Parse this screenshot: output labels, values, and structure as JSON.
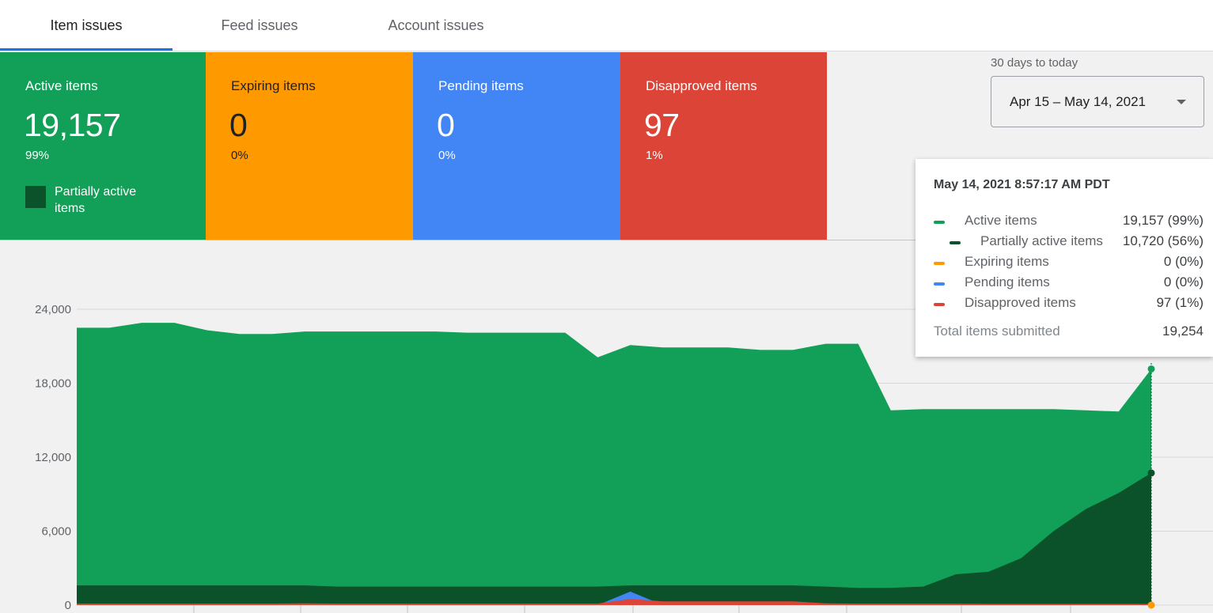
{
  "tabs": [
    {
      "label": "Item issues",
      "active": true
    },
    {
      "label": "Feed issues",
      "active": false
    },
    {
      "label": "Account issues",
      "active": false
    }
  ],
  "cards": {
    "active": {
      "label": "Active items",
      "value": "19,157",
      "percent": "99%",
      "color": "#129f57"
    },
    "expiring": {
      "label": "Expiring items",
      "value": "0",
      "percent": "0%",
      "color": "#ff9900"
    },
    "pending": {
      "label": "Pending items",
      "value": "0",
      "percent": "0%",
      "color": "#4285f4"
    },
    "disapproved": {
      "label": "Disapproved items",
      "value": "97",
      "percent": "1%",
      "color": "#db4437"
    },
    "partial_legend": "Partially active items"
  },
  "date_range": {
    "label": "30 days to today",
    "value": "Apr 15 – May 14, 2021"
  },
  "tooltip": {
    "title": "May 14, 2021 8:57:17 AM PDT",
    "rows": [
      {
        "name": "Active items",
        "value": "19,157 (99%)",
        "color": "#129f57"
      },
      {
        "name": "Partially active items",
        "value": "10,720 (56%)",
        "color": "#0b5129"
      },
      {
        "name": "Expiring items",
        "value": "0 (0%)",
        "color": "#ff9900"
      },
      {
        "name": "Pending items",
        "value": "0 (0%)",
        "color": "#4285f4"
      },
      {
        "name": "Disapproved items",
        "value": "97 (1%)",
        "color": "#db4437"
      }
    ],
    "total_label": "Total items submitted",
    "total_value": "19,254"
  },
  "chart_data": {
    "type": "area",
    "ylim": [
      0,
      24000
    ],
    "y_ticks": [
      "0",
      "6,000",
      "12,000",
      "18,000",
      "24,000"
    ],
    "grid": true,
    "series": [
      {
        "name": "Active items",
        "color": "#129f57",
        "values": [
          22500,
          22500,
          22900,
          22900,
          22300,
          22000,
          22000,
          22200,
          22200,
          22200,
          22200,
          22200,
          22100,
          22100,
          22100,
          22100,
          20100,
          21100,
          20900,
          20900,
          20900,
          20700,
          20700,
          21200,
          21200,
          15800,
          15900,
          15900,
          15900,
          15900,
          15900,
          15800,
          15700,
          19157
        ]
      },
      {
        "name": "Partially active items",
        "color": "#0b5129",
        "values": [
          1600,
          1600,
          1600,
          1600,
          1600,
          1600,
          1600,
          1600,
          1500,
          1500,
          1500,
          1500,
          1500,
          1500,
          1500,
          1500,
          1500,
          1600,
          1600,
          1600,
          1600,
          1600,
          1600,
          1500,
          1400,
          1400,
          1500,
          2500,
          2700,
          3800,
          6000,
          7800,
          9100,
          10720
        ]
      },
      {
        "name": "Pending items",
        "color": "#4285f4",
        "values": [
          0,
          0,
          0,
          0,
          0,
          0,
          0,
          0,
          0,
          0,
          0,
          0,
          0,
          0,
          0,
          0,
          0,
          1100,
          0,
          0,
          0,
          0,
          0,
          0,
          0,
          0,
          0,
          0,
          0,
          0,
          0,
          0,
          0,
          0
        ]
      },
      {
        "name": "Disapproved items",
        "color": "#db4437",
        "values": [
          120,
          120,
          120,
          120,
          120,
          120,
          120,
          150,
          120,
          120,
          120,
          120,
          120,
          120,
          120,
          120,
          120,
          500,
          300,
          300,
          300,
          300,
          300,
          150,
          120,
          120,
          120,
          120,
          100,
          100,
          100,
          100,
          100,
          97
        ]
      },
      {
        "name": "Expiring items",
        "color": "#ff9900",
        "values": [
          0,
          0,
          0,
          0,
          0,
          0,
          0,
          0,
          0,
          0,
          0,
          0,
          0,
          0,
          0,
          0,
          0,
          0,
          0,
          0,
          0,
          0,
          0,
          0,
          0,
          0,
          0,
          0,
          0,
          0,
          0,
          0,
          0,
          0
        ]
      }
    ]
  }
}
